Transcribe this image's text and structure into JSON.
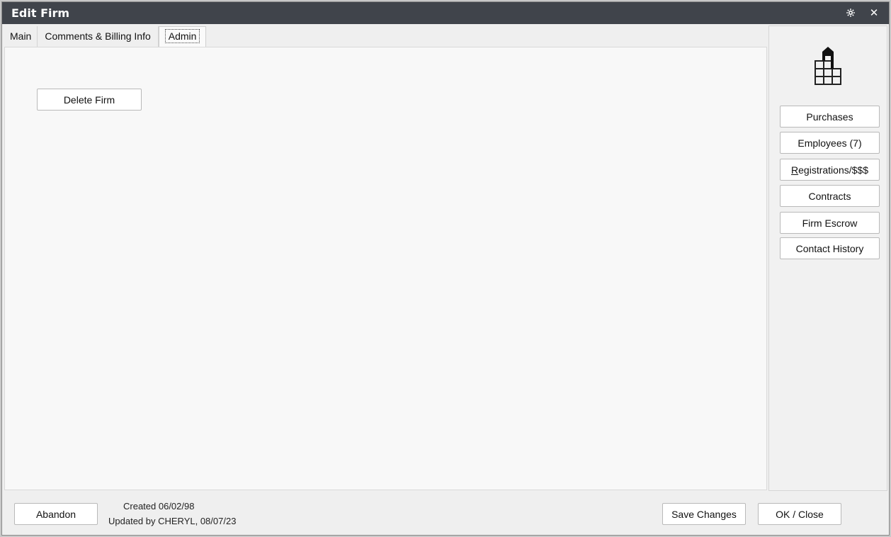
{
  "window": {
    "title": "Edit Firm"
  },
  "titlebar": {
    "settings_icon": "gear-icon",
    "close_symbol": "✕"
  },
  "tabs": [
    {
      "label": "Main"
    },
    {
      "label": "Comments & Billing Info"
    },
    {
      "label": "Admin",
      "active": true
    }
  ],
  "admin": {
    "delete_label": "Delete Firm"
  },
  "side": {
    "logo_icon": "building-icon",
    "buttons": [
      {
        "label": "Purchases"
      },
      {
        "label": "Employees (7)"
      },
      {
        "label": "Registrations/$$$",
        "underline": "R"
      },
      {
        "label": "Contracts"
      },
      {
        "label": "Firm Escrow"
      },
      {
        "label": "Contact History"
      }
    ]
  },
  "footer": {
    "abandon_label": "Abandon",
    "created_text": "Created 06/02/98",
    "updated_text": "Updated by CHERYL, 08/07/23",
    "save_label": "Save Changes",
    "ok_label": "OK / Close"
  }
}
